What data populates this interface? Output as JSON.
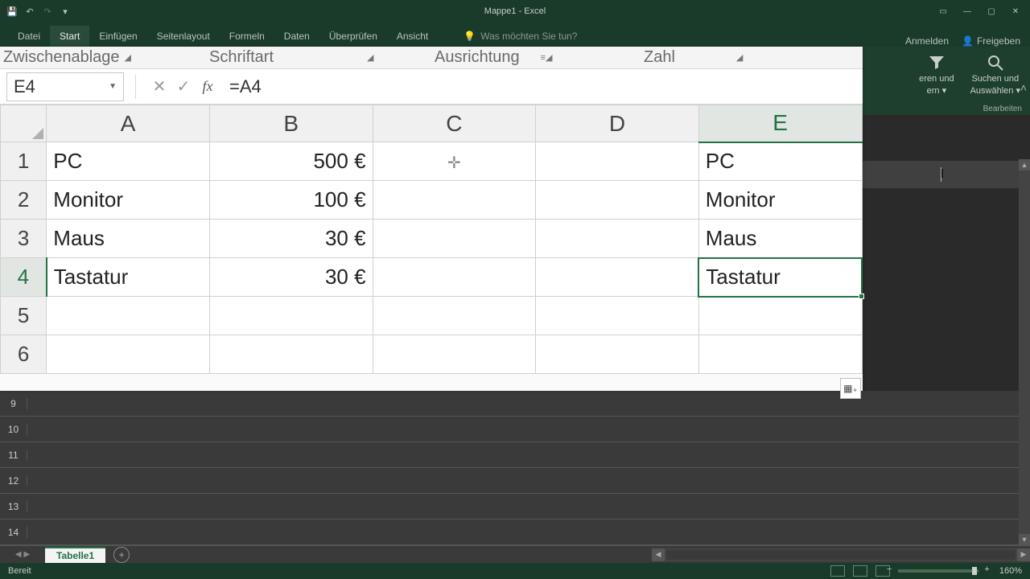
{
  "title": "Mappe1 - Excel",
  "qat": {
    "save": "💾",
    "undo": "↶",
    "redo": "↷"
  },
  "tabs": {
    "items": [
      "Datei",
      "Start",
      "Einfügen",
      "Seitenlayout",
      "Formeln",
      "Daten",
      "Überprüfen",
      "Ansicht"
    ],
    "active_index": 1,
    "tell_me": "Was möchten Sie tun?"
  },
  "account": {
    "signin": "Anmelden",
    "share": "Freigeben"
  },
  "ribbon_groups": {
    "clipboard": "Zwischenablage",
    "font": "Schriftart",
    "alignment": "Ausrichtung",
    "number": "Zahl",
    "sortfilter_l1": "eren und",
    "sortfilter_l2": "ern",
    "findselect_l1": "Suchen und",
    "findselect_l2": "Auswählen",
    "editing": "Bearbeiten"
  },
  "name_box": "E4",
  "formula": "=A4",
  "columns": [
    "A",
    "B",
    "C",
    "D",
    "E"
  ],
  "selected_col_index": 4,
  "rows": [
    {
      "n": "1",
      "A": "PC",
      "B": "500 €",
      "C": "",
      "D": "",
      "E": "PC"
    },
    {
      "n": "2",
      "A": "Monitor",
      "B": "100 €",
      "C": "",
      "D": "",
      "E": "Monitor"
    },
    {
      "n": "3",
      "A": "Maus",
      "B": "30 €",
      "C": "",
      "D": "",
      "E": "Maus"
    },
    {
      "n": "4",
      "A": "Tastatur",
      "B": "30 €",
      "C": "",
      "D": "",
      "E": "Tastatur"
    },
    {
      "n": "5",
      "A": "",
      "B": "",
      "C": "",
      "D": "",
      "E": ""
    },
    {
      "n": "6",
      "A": "",
      "B": "",
      "C": "",
      "D": "",
      "E": ""
    }
  ],
  "selected_cell": {
    "row": 3,
    "col": "E"
  },
  "cursor_symbol": "✛",
  "bg_row_numbers": [
    "9",
    "10",
    "11",
    "12",
    "13",
    "14"
  ],
  "sheet": {
    "active": "Tabelle1"
  },
  "status": {
    "ready": "Bereit",
    "zoom": "160%"
  }
}
